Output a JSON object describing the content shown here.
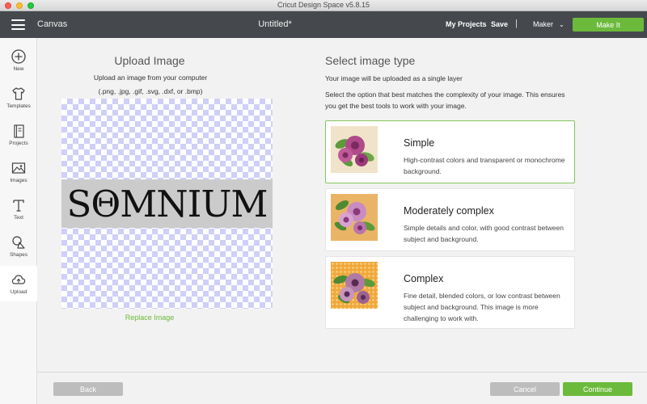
{
  "window": {
    "title": "Cricut Design Space  v5.8.15"
  },
  "header": {
    "app_name": "Canvas",
    "document_title": "Untitled*",
    "my_projects": "My Projects",
    "save": "Save",
    "separator": "|",
    "machine": "Maker",
    "make_it": "Make It"
  },
  "sidebar": {
    "items": [
      {
        "label": "New",
        "icon": "plus-circle-icon"
      },
      {
        "label": "Templates",
        "icon": "tshirt-icon"
      },
      {
        "label": "Projects",
        "icon": "book-icon"
      },
      {
        "label": "Images",
        "icon": "image-icon"
      },
      {
        "label": "Text",
        "icon": "text-t-icon"
      },
      {
        "label": "Shapes",
        "icon": "shapes-icon"
      },
      {
        "label": "Upload",
        "icon": "cloud-upload-icon",
        "active": true
      }
    ]
  },
  "upload_panel": {
    "title": "Upload Image",
    "subtitle": "Upload an image from your computer",
    "formats": "(.png, .jpg, .gif, .svg, .dxf, or .bmp)",
    "preview_text": "SΘMNIUM",
    "replace_link": "Replace Image"
  },
  "type_panel": {
    "title": "Select image type",
    "subtitle": "Your image will be uploaded as a single layer",
    "description": "Select the option that best matches the complexity of your image. This ensures you get the best tools to work with your image.",
    "options": [
      {
        "title": "Simple",
        "description": "High-contrast colors and transparent or monochrome background.",
        "selected": true,
        "thumb_bg": "#f0e3ca"
      },
      {
        "title": "Moderately complex",
        "description": "Simple details and color, with good contrast between subject and background.",
        "selected": false,
        "thumb_bg": "#eab466"
      },
      {
        "title": "Complex",
        "description": "Fine detail, blended colors, or low contrast between subject and background. This image is more challenging to work with.",
        "selected": false,
        "thumb_bg": "#f0a83a"
      }
    ]
  },
  "footer": {
    "back": "Back",
    "cancel": "Cancel",
    "continue": "Continue"
  },
  "colors": {
    "accent": "#6cba3c",
    "header_bg": "#45494d",
    "checker": "#cfcff7",
    "disabled_button": "#bdbdbd"
  }
}
